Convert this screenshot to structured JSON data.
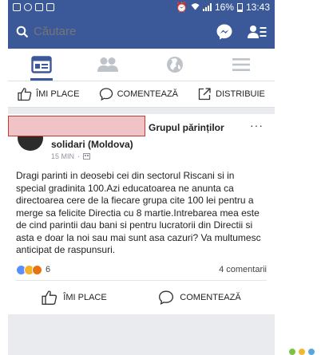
{
  "status_bar": {
    "battery": "16%",
    "time": "13:43"
  },
  "search": {
    "placeholder": "Căutare"
  },
  "nav_tabs": [
    {
      "icon": "news-feed-icon",
      "active": true
    },
    {
      "icon": "friends-icon",
      "active": false
    },
    {
      "icon": "globe-icon",
      "active": false
    },
    {
      "icon": "menu-icon",
      "active": false
    }
  ],
  "prev_post_actions": {
    "like": "ÎMI PLACE",
    "comment": "COMENTEAZĂ",
    "share": "DISTRIBUIE"
  },
  "post": {
    "group_name_line1": "Grupul părinților",
    "group_name_line2": "solidari (Moldova)",
    "time": "15 MIN",
    "more": "···",
    "text": "Dragi parinti in deosebi cei din sectorul Riscani si in special gradinita 100.Azi educatoarea ne anunta ca directoarea cere de la fiecare grupa cite 100 lei pentru a merge sa felicite Directia cu 8 martie.Intrebarea mea este de cind parintii dau bani si pentru lucratorii din Directii si asta e doar la noi sau mai sunt asa cazuri? Va multumesc anticipat de raspunsuri.",
    "reaction_count": "6",
    "comments": "4 comentarii",
    "like": "ÎMI PLACE",
    "comment": "COMENTEAZĂ"
  },
  "colors": {
    "brand": "#3b5998",
    "redaction": "#c23b3b"
  }
}
